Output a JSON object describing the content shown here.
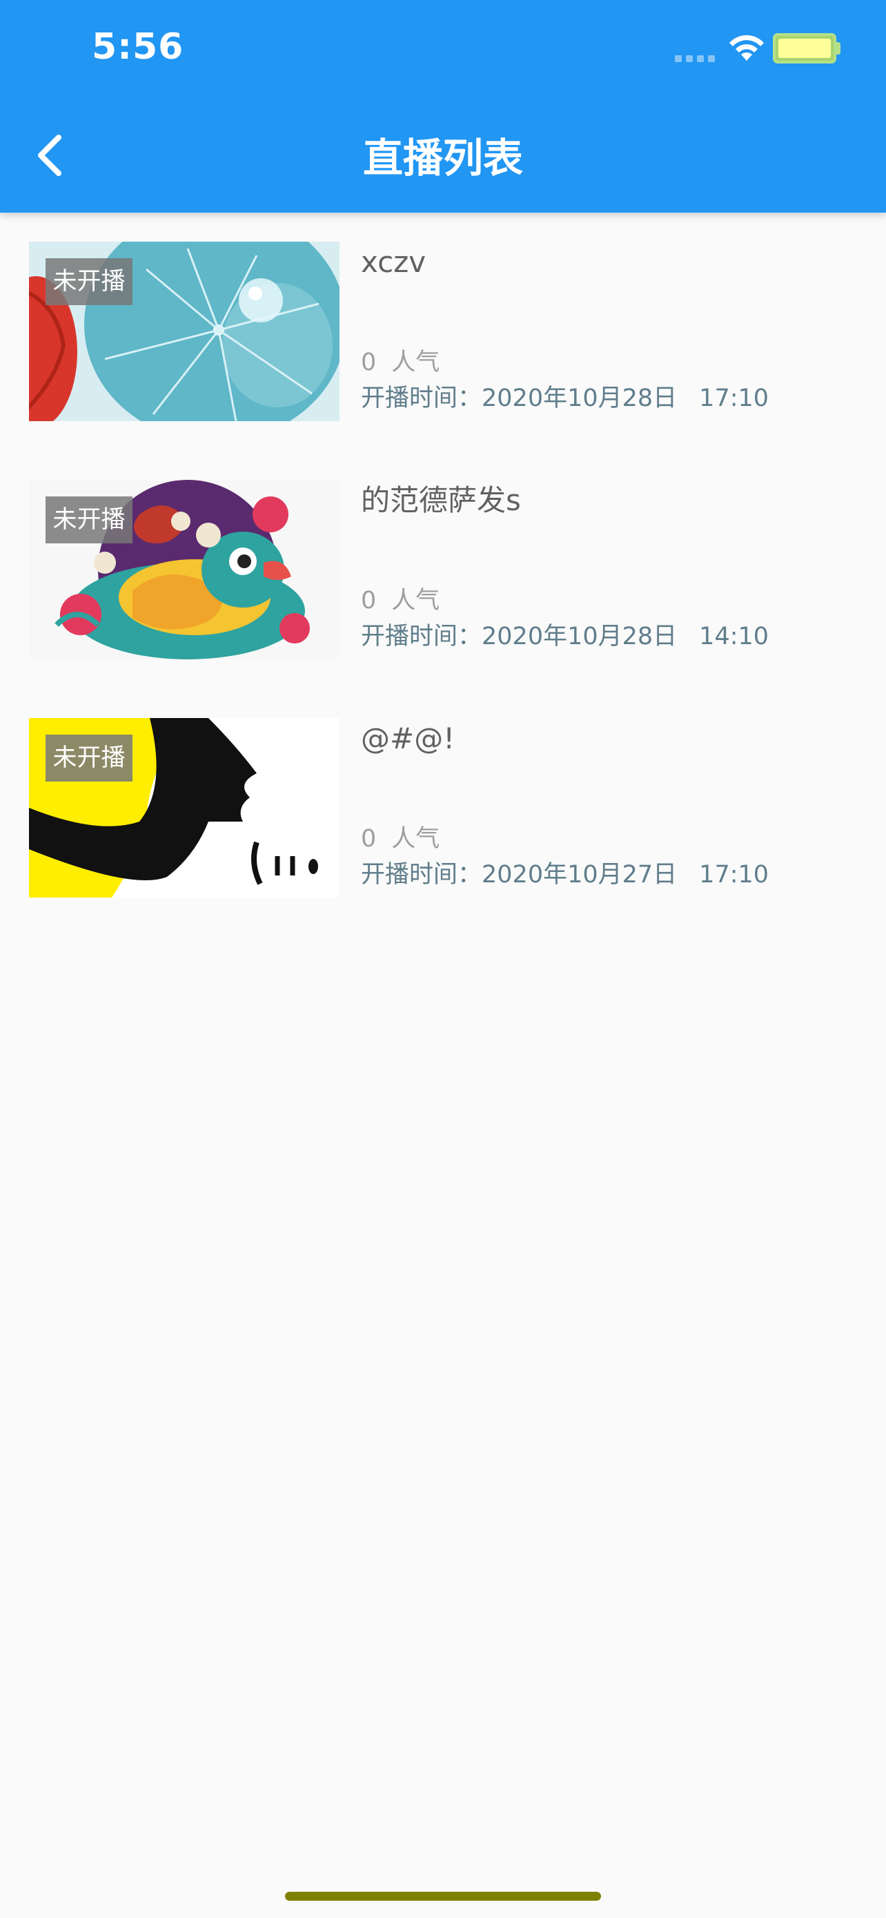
{
  "status_bar": {
    "time": "5:56"
  },
  "nav": {
    "title": "直播列表",
    "back_icon": "chevron-left-icon"
  },
  "colors": {
    "app_bar": "#2196f3",
    "time_text": "#607d8b",
    "title_text": "#616161",
    "popularity_text": "#9e9e9e",
    "badge_bg": "#787878"
  },
  "streams": [
    {
      "badge": "未开播",
      "title": "xczv",
      "count": "0",
      "popularity_label": "人气",
      "time_label": "开播时间：",
      "date": "2020年10月28日",
      "time": "17:10",
      "thumbnail": "lotus-leaf-image"
    },
    {
      "badge": "未开播",
      "title": "的范德萨发s",
      "count": "0",
      "popularity_label": "人气",
      "time_label": "开播时间：",
      "date": "2020年10月28日",
      "time": "14:10",
      "thumbnail": "rooster-fish-illustration"
    },
    {
      "badge": "未开播",
      "title": "@#@!",
      "count": "0",
      "popularity_label": "人气",
      "time_label": "开播时间：",
      "date": "2020年10月27日",
      "time": "17:10",
      "thumbnail": "yellow-black-graphic"
    }
  ]
}
